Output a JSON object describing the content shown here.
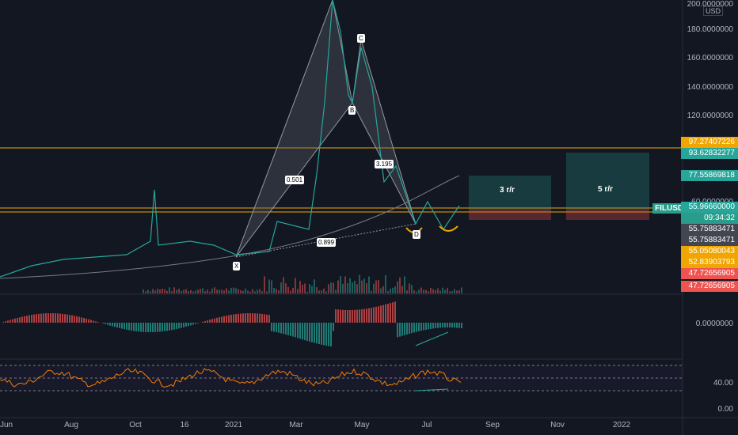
{
  "symbol": "FILUSD",
  "currency": "USD",
  "countdown": "09:34:32",
  "price_scale": {
    "ticks": [
      "200.0000000",
      "180.0000000",
      "160.0000000",
      "140.0000000",
      "120.0000000",
      "60.0000000",
      "0.0000000",
      "40.00",
      "0.00"
    ]
  },
  "price_labels": [
    {
      "text": "97.27407226",
      "color": "#f0a500"
    },
    {
      "text": "93.62832277",
      "color": "#26a69a"
    },
    {
      "text": "77.55869818",
      "color": "#26a69a"
    },
    {
      "text": "55.96660000",
      "color": "#26a69a"
    },
    {
      "text": "55.75883471",
      "color": "#434651"
    },
    {
      "text": "55.75883471",
      "color": "#434651"
    },
    {
      "text": "55.05080043",
      "color": "#f0a500"
    },
    {
      "text": "52.83903793",
      "color": "#f0a500"
    },
    {
      "text": "47.72656905",
      "color": "#ef5350"
    },
    {
      "text": "47.72656905",
      "color": "#ef5350"
    }
  ],
  "x_axis": [
    "Jun",
    "Aug",
    "Oct",
    "16",
    "2021",
    "Mar",
    "May",
    "Jul",
    "Sep",
    "Nov",
    "2022"
  ],
  "pattern": {
    "points": [
      "X",
      "B",
      "C",
      "D"
    ],
    "ratios": [
      "0.501",
      "0.899",
      "3.195"
    ]
  },
  "targets": [
    "3 r/r",
    "5 r/r"
  ],
  "colors": {
    "up": "#26a69a",
    "down": "#ef5350",
    "orange": "#f0a500"
  }
}
